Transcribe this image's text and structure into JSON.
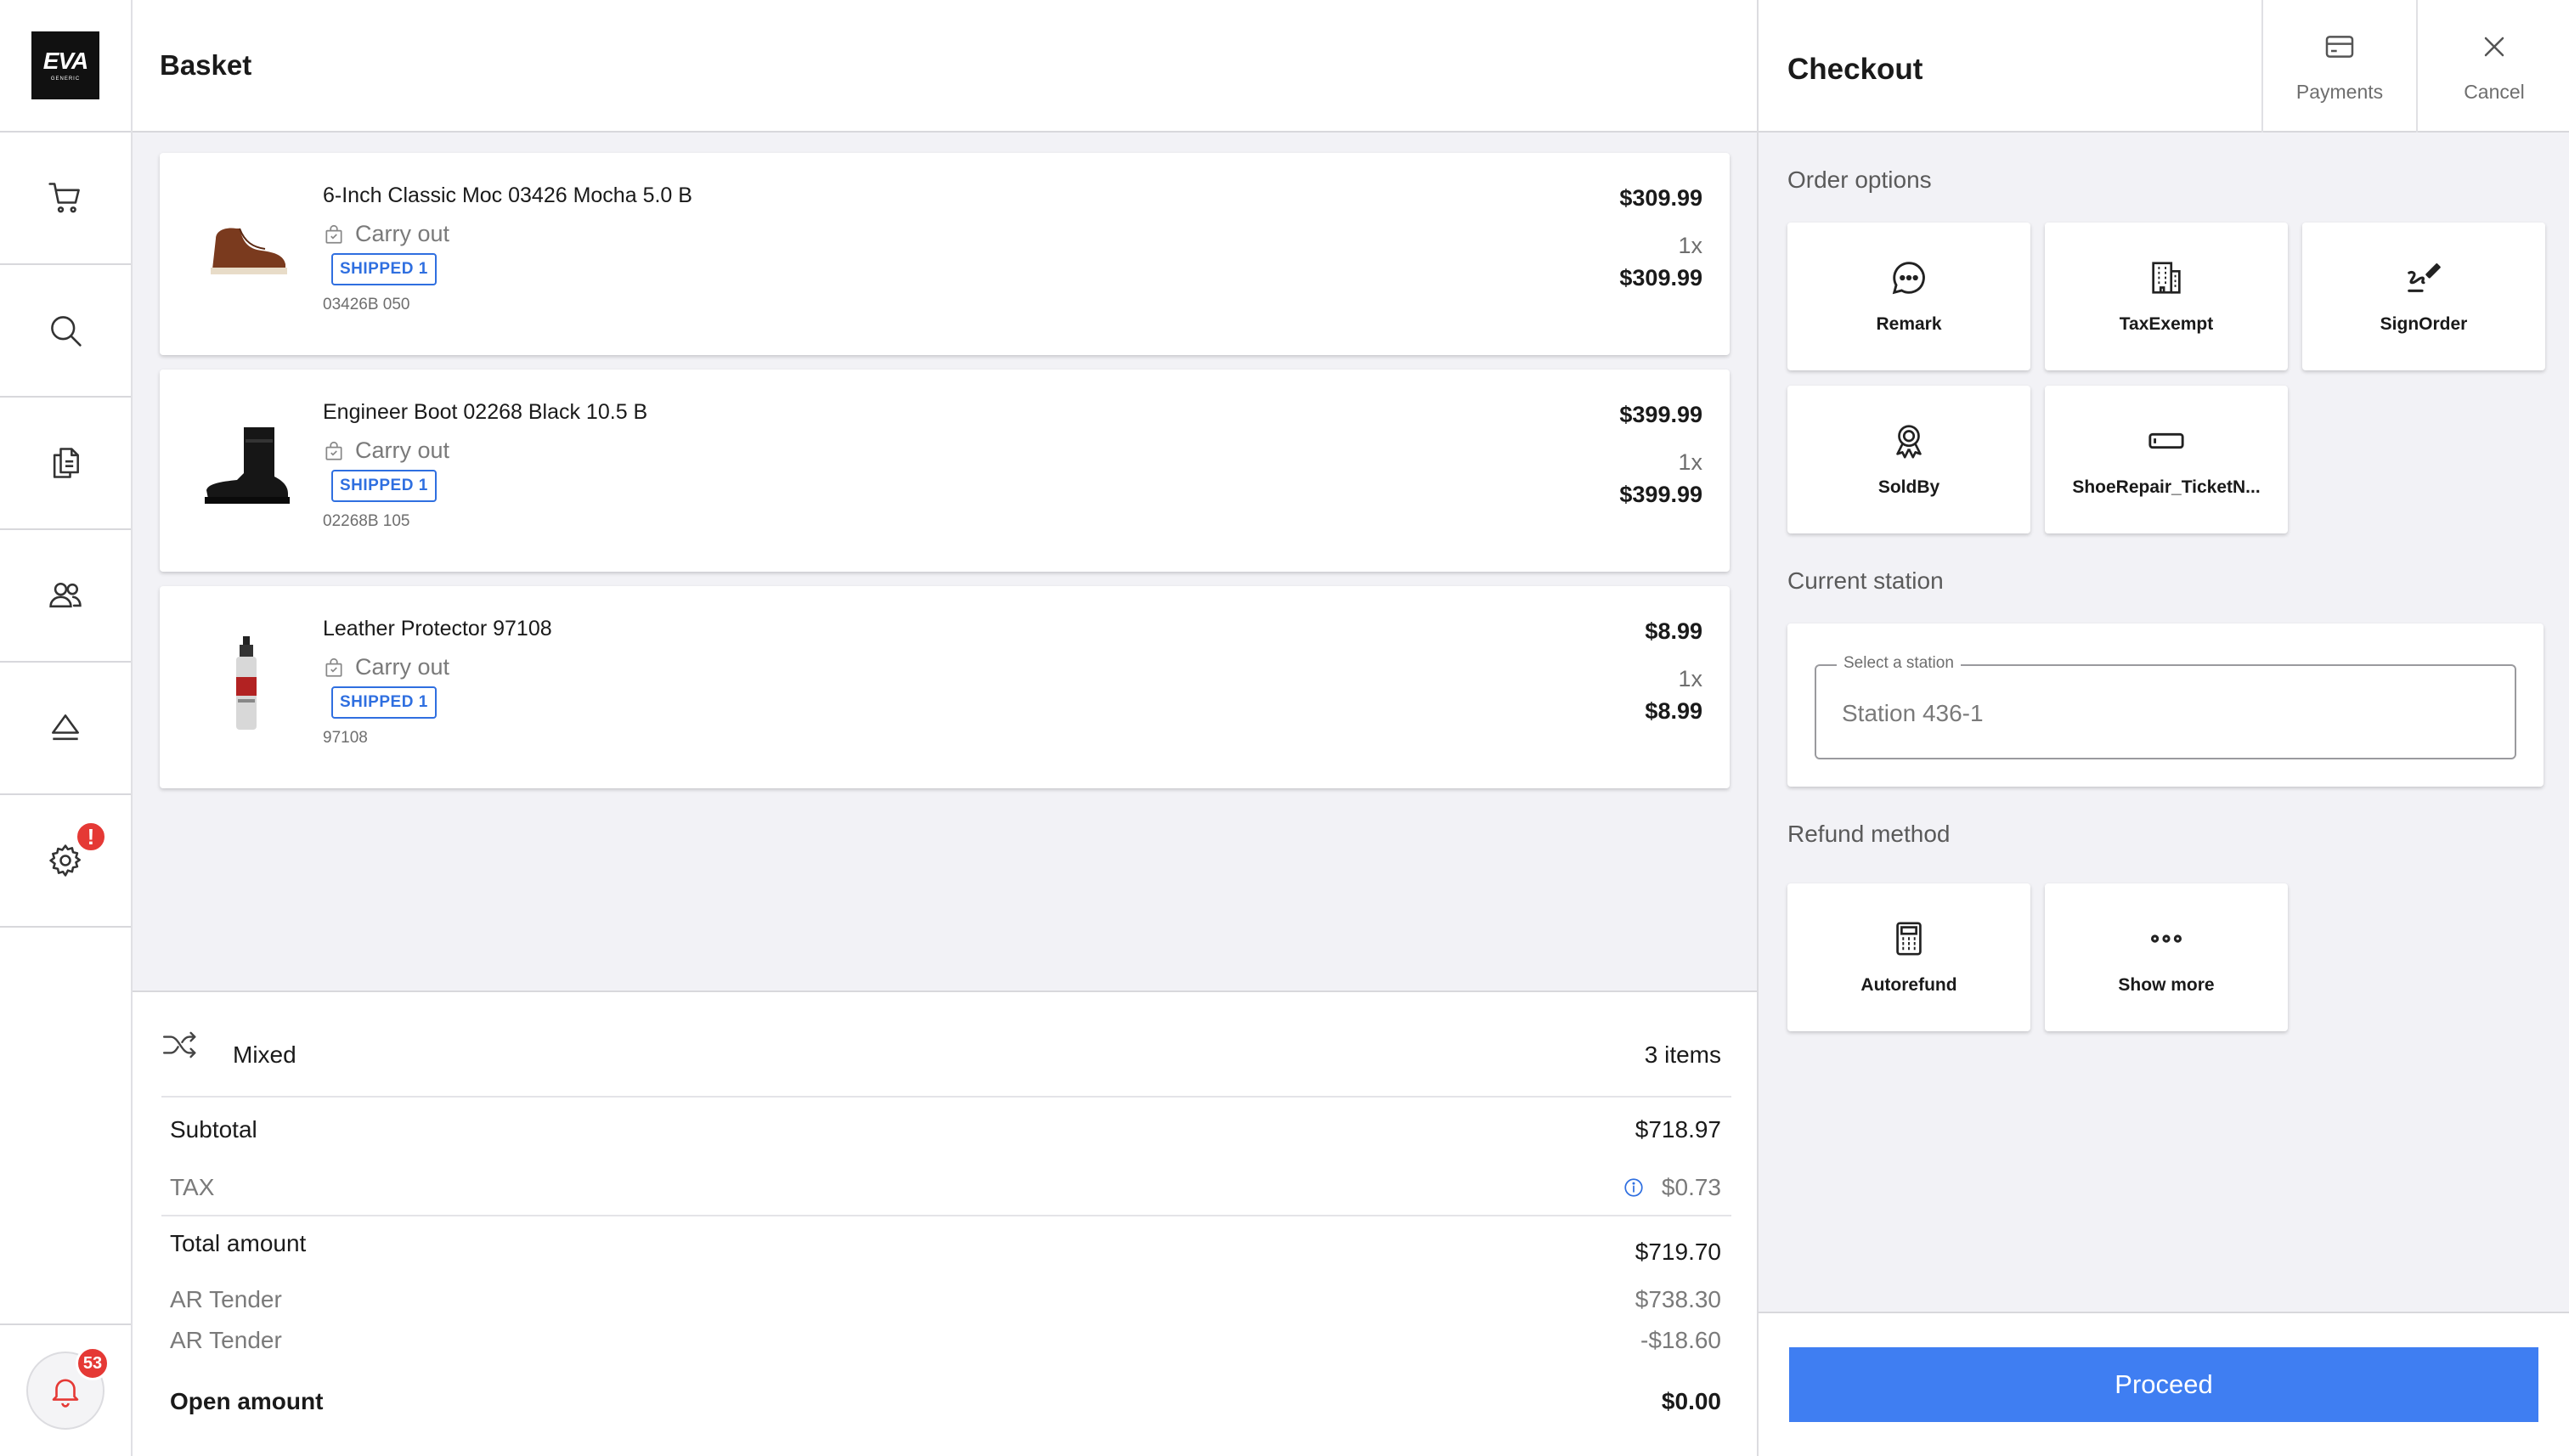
{
  "brand": {
    "logo_text": "EVA",
    "logo_sub": "GENERIC"
  },
  "sidebar": {
    "items": [
      {
        "icon": "cart-icon"
      },
      {
        "icon": "search-icon"
      },
      {
        "icon": "documents-icon"
      },
      {
        "icon": "users-icon"
      },
      {
        "icon": "eject-icon"
      },
      {
        "icon": "gear-icon",
        "badge": "!"
      }
    ],
    "notifications": {
      "icon": "bell-icon",
      "count": "53"
    }
  },
  "basket": {
    "title": "Basket",
    "items": [
      {
        "name": "6-Inch Classic Moc 03426 Mocha 5.0 B",
        "delivery": "Carry out",
        "badge": "SHIPPED 1",
        "sku": "03426B 050",
        "price": "$309.99",
        "quantity": "1x",
        "total": "$309.99"
      },
      {
        "name": "Engineer Boot 02268 Black 10.5 B",
        "delivery": "Carry out",
        "badge": "SHIPPED 1",
        "sku": "02268B 105",
        "price": "$399.99",
        "quantity": "1x",
        "total": "$399.99"
      },
      {
        "name": "Leather Protector 97108",
        "delivery": "Carry out",
        "badge": "SHIPPED 1",
        "sku": "97108",
        "price": "$8.99",
        "quantity": "1x",
        "total": "$8.99"
      }
    ]
  },
  "summary": {
    "mixed_label": "Mixed",
    "items_count": "3 items",
    "subtotal_label": "Subtotal",
    "subtotal": "$718.97",
    "tax_label": "TAX",
    "tax": "$0.73",
    "total_label": "Total amount",
    "total": "$719.70",
    "tenders": [
      {
        "label": "AR Tender",
        "amount": "$738.30"
      },
      {
        "label": "AR Tender",
        "amount": "-$18.60"
      }
    ],
    "open_label": "Open amount",
    "open": "$0.00"
  },
  "checkout": {
    "title": "Checkout",
    "payments_label": "Payments",
    "cancel_label": "Cancel",
    "order_options_title": "Order options",
    "order_options": [
      {
        "label": "Remark",
        "icon": "speech-bubble-icon"
      },
      {
        "label": "TaxExempt",
        "icon": "building-icon"
      },
      {
        "label": "SignOrder",
        "icon": "signature-icon"
      },
      {
        "label": "SoldBy",
        "icon": "award-icon"
      },
      {
        "label": "ShoeRepair_TicketN...",
        "icon": "ticket-icon"
      }
    ],
    "station_title": "Current station",
    "station_label": "Select a station",
    "station_value": "Station 436-1",
    "refund_title": "Refund method",
    "refund_options": [
      {
        "label": "Autorefund",
        "icon": "calculator-icon"
      },
      {
        "label": "Show more",
        "icon": "more-dots-icon"
      }
    ],
    "proceed_label": "Proceed"
  },
  "colors": {
    "accent": "#3f7ef2",
    "badge_red": "#e53935",
    "shipped_blue": "#2f6fe0"
  }
}
